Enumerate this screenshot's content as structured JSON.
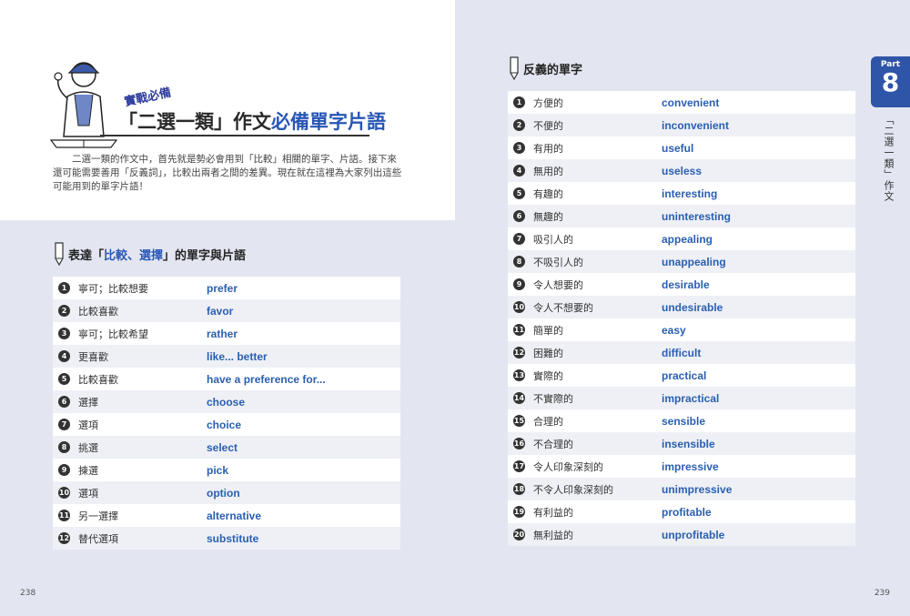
{
  "left": {
    "badge": "實戰必備",
    "title_pre": "「二選一類」作文",
    "title_accent": "必備單字片語",
    "intro": "二選一類的作文中，首先就是勢必會用到「比較」相關的單字、片語。接下來還可能需要善用「反義詞」，比較出兩者之間的差異。現在就在這裡為大家列出這些可能用到的單字片語！",
    "section_pre": "表達「",
    "section_hl": "比較、選擇",
    "section_post": "」的單字與片語",
    "rows": [
      {
        "n": "1",
        "zh": "寧可；比較想要",
        "en": "prefer"
      },
      {
        "n": "2",
        "zh": "比較喜歡",
        "en": "favor"
      },
      {
        "n": "3",
        "zh": "寧可；比較希望",
        "en": "rather"
      },
      {
        "n": "4",
        "zh": "更喜歡",
        "en": "like... better"
      },
      {
        "n": "5",
        "zh": "比較喜歡",
        "en": "have a preference for..."
      },
      {
        "n": "6",
        "zh": "選擇",
        "en": "choose"
      },
      {
        "n": "7",
        "zh": "選項",
        "en": "choice"
      },
      {
        "n": "8",
        "zh": "挑選",
        "en": "select"
      },
      {
        "n": "9",
        "zh": "揀選",
        "en": "pick"
      },
      {
        "n": "10",
        "zh": "選項",
        "en": "option"
      },
      {
        "n": "11",
        "zh": "另一選擇",
        "en": "alternative"
      },
      {
        "n": "12",
        "zh": "替代選項",
        "en": "substitute"
      }
    ],
    "page_number": "238"
  },
  "right": {
    "section_title": "反義的單字",
    "rows": [
      {
        "n": "1",
        "zh": "方便的",
        "en": "convenient"
      },
      {
        "n": "2",
        "zh": "不便的",
        "en": "inconvenient"
      },
      {
        "n": "3",
        "zh": "有用的",
        "en": "useful"
      },
      {
        "n": "4",
        "zh": "無用的",
        "en": "useless"
      },
      {
        "n": "5",
        "zh": "有趣的",
        "en": "interesting"
      },
      {
        "n": "6",
        "zh": "無趣的",
        "en": "uninteresting"
      },
      {
        "n": "7",
        "zh": "吸引人的",
        "en": "appealing"
      },
      {
        "n": "8",
        "zh": "不吸引人的",
        "en": "unappealing"
      },
      {
        "n": "9",
        "zh": "令人想要的",
        "en": "desirable"
      },
      {
        "n": "10",
        "zh": "令人不想要的",
        "en": "undesirable"
      },
      {
        "n": "11",
        "zh": "簡單的",
        "en": "easy"
      },
      {
        "n": "12",
        "zh": "困難的",
        "en": "difficult"
      },
      {
        "n": "13",
        "zh": "實際的",
        "en": "practical"
      },
      {
        "n": "14",
        "zh": "不實際的",
        "en": "impractical"
      },
      {
        "n": "15",
        "zh": "合理的",
        "en": "sensible"
      },
      {
        "n": "16",
        "zh": "不合理的",
        "en": "insensible"
      },
      {
        "n": "17",
        "zh": "令人印象深刻的",
        "en": "impressive"
      },
      {
        "n": "18",
        "zh": "不令人印象深刻的",
        "en": "unimpressive"
      },
      {
        "n": "19",
        "zh": "有利益的",
        "en": "profitable"
      },
      {
        "n": "20",
        "zh": "無利益的",
        "en": "unprofitable"
      }
    ],
    "part_label": "Part",
    "part_number": "8",
    "vertical_label": "「二選一類」作文",
    "page_number": "239"
  },
  "colors": {
    "accent": "#2856b5",
    "tab": "#2f55a8",
    "page_bg": "#e3e6f1"
  }
}
